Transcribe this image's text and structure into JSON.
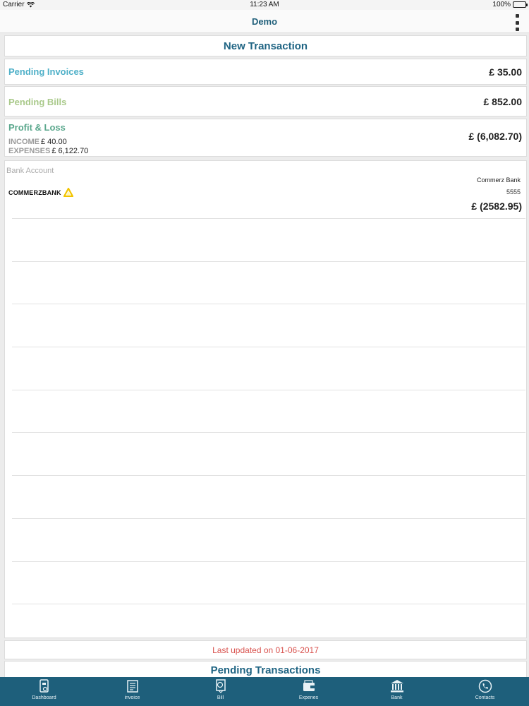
{
  "status_bar": {
    "carrier": "Carrier",
    "time": "11:23 AM",
    "battery": "100%"
  },
  "nav": {
    "title": "Demo",
    "menu_icon": "kebab-menu-icon"
  },
  "new_transaction": {
    "label": "New Transaction"
  },
  "pending_invoices": {
    "label": "Pending Invoices",
    "amount": "£ 35.00"
  },
  "pending_bills": {
    "label": "Pending Bills",
    "amount": "£ 852.00"
  },
  "profit_loss": {
    "label": "Profit & Loss",
    "income_label": "INCOME",
    "income_value": "£ 40.00",
    "expenses_label": "EXPENSES",
    "expenses_value": "£ 6,122.70",
    "amount": "£ (6,082.70)"
  },
  "bank_account": {
    "section_label": "Bank Account",
    "logo_text": "COMMERZBANK",
    "bank_name": "Commerz Bank",
    "account_number": "5555",
    "balance": "£ (2582.95)"
  },
  "last_updated": "Last updated on 01-06-2017",
  "pending_transactions": {
    "label": "Pending Transactions"
  },
  "colors": {
    "nav_title": "#1f5f7a",
    "tabbar": "#1e5f7b",
    "invoices": "#4fb0c8",
    "bills": "#a9c98a",
    "profit_loss": "#5aa78c",
    "updated": "#d9534f"
  },
  "tabs": [
    {
      "label": "Dashboard",
      "icon": "dashboard-icon"
    },
    {
      "label": "invoice",
      "icon": "invoice-icon"
    },
    {
      "label": "Bill",
      "icon": "bill-icon"
    },
    {
      "label": "Expenes",
      "icon": "wallet-icon"
    },
    {
      "label": "Bank",
      "icon": "bank-icon"
    },
    {
      "label": "Contacts",
      "icon": "phone-icon"
    }
  ]
}
